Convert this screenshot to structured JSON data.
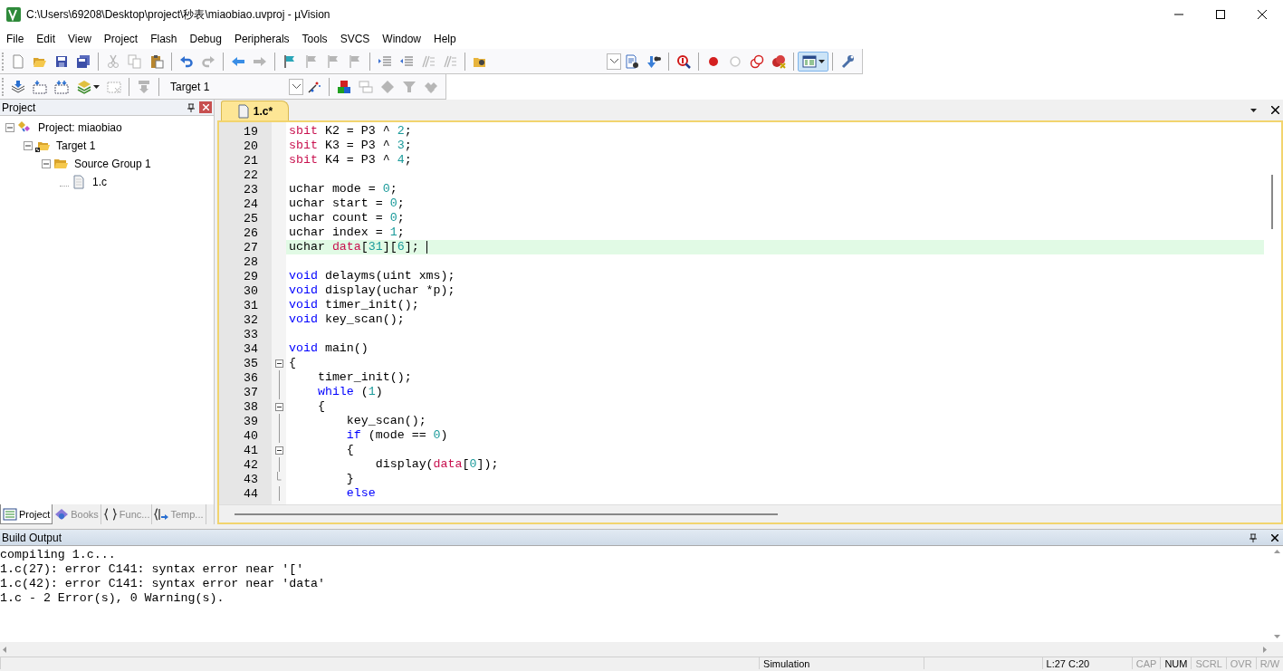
{
  "window": {
    "title": "C:\\Users\\69208\\Desktop\\project\\秒表\\miaobiao.uvproj - µVision"
  },
  "menu": [
    "File",
    "Edit",
    "View",
    "Project",
    "Flash",
    "Debug",
    "Peripherals",
    "Tools",
    "SVCS",
    "Window",
    "Help"
  ],
  "toolbar_1": [
    {
      "kind": "new-file",
      "disabled": false,
      "pressed": false
    },
    {
      "kind": "open-folder",
      "disabled": false,
      "pressed": false
    },
    {
      "kind": "save",
      "disabled": false,
      "pressed": false
    },
    {
      "kind": "save-all",
      "disabled": false,
      "pressed": false
    },
    {
      "kind": "separator"
    },
    {
      "kind": "scissors",
      "disabled": true,
      "pressed": false
    },
    {
      "kind": "copy",
      "disabled": true,
      "pressed": false
    },
    {
      "kind": "paste",
      "disabled": false,
      "pressed": false
    },
    {
      "kind": "separator"
    },
    {
      "kind": "undo",
      "disabled": false,
      "pressed": false
    },
    {
      "kind": "redo",
      "disabled": true,
      "pressed": false
    },
    {
      "kind": "separator"
    },
    {
      "kind": "left-arrow",
      "disabled": false,
      "pressed": false
    },
    {
      "kind": "right-arrow",
      "disabled": true,
      "pressed": false
    },
    {
      "kind": "separator"
    },
    {
      "kind": "flag",
      "disabled": false,
      "pressed": false
    },
    {
      "kind": "flag",
      "disabled": true,
      "pressed": false
    },
    {
      "kind": "flag",
      "disabled": true,
      "pressed": false
    },
    {
      "kind": "flag",
      "disabled": true,
      "pressed": false
    },
    {
      "kind": "separator"
    },
    {
      "kind": "indent",
      "disabled": false,
      "pressed": false
    },
    {
      "kind": "unindent",
      "disabled": false,
      "pressed": false
    },
    {
      "kind": "comment",
      "disabled": true,
      "pressed": false
    },
    {
      "kind": "uncomment",
      "disabled": true,
      "pressed": false
    },
    {
      "kind": "separator"
    },
    {
      "kind": "folder-search",
      "disabled": false,
      "pressed": false
    },
    {
      "kind": "combo"
    },
    {
      "kind": "document-search",
      "disabled": false,
      "pressed": false
    },
    {
      "kind": "arrow-binoculars",
      "disabled": false,
      "pressed": false
    },
    {
      "kind": "separator"
    },
    {
      "kind": "debug",
      "disabled": false,
      "pressed": false
    },
    {
      "kind": "separator"
    },
    {
      "kind": "breakpoint",
      "disabled": false,
      "pressed": false
    },
    {
      "kind": "hollow-circle",
      "disabled": true,
      "pressed": false
    },
    {
      "kind": "circles",
      "disabled": false,
      "pressed": false
    },
    {
      "kind": "dot-cross",
      "disabled": false,
      "pressed": false
    },
    {
      "kind": "separator"
    },
    {
      "kind": "window-layout",
      "disabled": false,
      "pressed": true
    },
    {
      "kind": "separator"
    },
    {
      "kind": "wrench",
      "disabled": false,
      "pressed": false
    }
  ],
  "toolbar_2": [
    {
      "kind": "stack-arrow",
      "disabled": false,
      "pressed": false
    },
    {
      "kind": "build",
      "disabled": false,
      "pressed": false
    },
    {
      "kind": "rebuild",
      "disabled": false,
      "pressed": false
    },
    {
      "kind": "layers",
      "disabled": false,
      "pressed": false
    },
    {
      "kind": "stop-build",
      "disabled": true,
      "pressed": false
    },
    {
      "kind": "separator"
    },
    {
      "kind": "load",
      "disabled": true,
      "pressed": false
    },
    {
      "kind": "separator"
    },
    {
      "kind": "target"
    },
    {
      "kind": "magic-wand",
      "disabled": false,
      "pressed": false
    },
    {
      "kind": "separator"
    },
    {
      "kind": "blocks",
      "disabled": false,
      "pressed": false
    },
    {
      "kind": "windows",
      "disabled": true,
      "pressed": false
    },
    {
      "kind": "diamond",
      "disabled": true,
      "pressed": false
    },
    {
      "kind": "funnel",
      "disabled": true,
      "pressed": false
    },
    {
      "kind": "diamonds",
      "disabled": true,
      "pressed": false
    }
  ],
  "target": "Target 1",
  "project_panel": {
    "title": "Project",
    "tree": [
      {
        "label": "Project: miaobiao",
        "kind": "project",
        "expanded": true,
        "children": [
          {
            "label": "Target 1",
            "kind": "target",
            "expanded": true,
            "children": [
              {
                "label": "Source Group 1",
                "kind": "group",
                "expanded": true,
                "children": [
                  {
                    "label": "1.c",
                    "kind": "file"
                  }
                ]
              }
            ]
          }
        ]
      }
    ],
    "tabs": [
      {
        "label": "Project",
        "kind": "project",
        "selected": true
      },
      {
        "label": "Books",
        "kind": "books",
        "selected": false
      },
      {
        "label": "Func...",
        "kind": "functions",
        "selected": false
      },
      {
        "label": "Temp...",
        "kind": "templates",
        "selected": false
      }
    ]
  },
  "editor": {
    "tabs": [
      {
        "label": "1.c*",
        "selected": true
      }
    ],
    "lines": [
      {
        "no": "19",
        "kind": "plain",
        "current": false,
        "tokens": [
          {
            "kind": "special",
            "text": "sbit"
          },
          {
            "kind": "plain",
            "text": " K2 = P3 ^ "
          },
          {
            "kind": "number",
            "text": "2"
          },
          {
            "kind": "plain",
            "text": ";"
          }
        ]
      },
      {
        "no": "20",
        "kind": "plain",
        "current": false,
        "tokens": [
          {
            "kind": "special",
            "text": "sbit"
          },
          {
            "kind": "plain",
            "text": " K3 = P3 ^ "
          },
          {
            "kind": "number",
            "text": "3"
          },
          {
            "kind": "plain",
            "text": ";"
          }
        ]
      },
      {
        "no": "21",
        "kind": "plain",
        "current": false,
        "tokens": [
          {
            "kind": "special",
            "text": "sbit"
          },
          {
            "kind": "plain",
            "text": " K4 = P3 ^ "
          },
          {
            "kind": "number",
            "text": "4"
          },
          {
            "kind": "plain",
            "text": ";"
          }
        ]
      },
      {
        "no": "22",
        "kind": "plain",
        "current": false
      },
      {
        "no": "23",
        "kind": "plain",
        "current": false,
        "tokens": [
          {
            "kind": "plain",
            "text": "uchar mode = "
          },
          {
            "kind": "number",
            "text": "0"
          },
          {
            "kind": "plain",
            "text": ";"
          }
        ]
      },
      {
        "no": "24",
        "kind": "plain",
        "current": false,
        "tokens": [
          {
            "kind": "plain",
            "text": "uchar start = "
          },
          {
            "kind": "number",
            "text": "0"
          },
          {
            "kind": "plain",
            "text": ";"
          }
        ]
      },
      {
        "no": "25",
        "kind": "plain",
        "current": false,
        "tokens": [
          {
            "kind": "plain",
            "text": "uchar count = "
          },
          {
            "kind": "number",
            "text": "0"
          },
          {
            "kind": "plain",
            "text": ";"
          }
        ]
      },
      {
        "no": "26",
        "kind": "plain",
        "current": false,
        "tokens": [
          {
            "kind": "plain",
            "text": "uchar index = "
          },
          {
            "kind": "number",
            "text": "1"
          },
          {
            "kind": "plain",
            "text": ";"
          }
        ]
      },
      {
        "no": "27",
        "kind": "plain",
        "current": true,
        "tokens": [
          {
            "kind": "plain",
            "text": "uchar "
          },
          {
            "kind": "special",
            "text": "data"
          },
          {
            "kind": "plain",
            "text": "["
          },
          {
            "kind": "number",
            "text": "31"
          },
          {
            "kind": "plain",
            "text": "]["
          },
          {
            "kind": "number",
            "text": "6"
          },
          {
            "kind": "plain",
            "text": "];"
          }
        ]
      },
      {
        "no": "28",
        "kind": "plain",
        "current": false
      },
      {
        "no": "29",
        "kind": "plain",
        "current": false,
        "tokens": [
          {
            "kind": "keyword",
            "text": "void"
          },
          {
            "kind": "plain",
            "text": " delayms(uint xms);"
          }
        ]
      },
      {
        "no": "30",
        "kind": "plain",
        "current": false,
        "tokens": [
          {
            "kind": "keyword",
            "text": "void"
          },
          {
            "kind": "plain",
            "text": " display(uchar *p);"
          }
        ]
      },
      {
        "no": "31",
        "kind": "plain",
        "current": false,
        "tokens": [
          {
            "kind": "keyword",
            "text": "void"
          },
          {
            "kind": "plain",
            "text": " timer_init();"
          }
        ]
      },
      {
        "no": "32",
        "kind": "plain",
        "current": false,
        "tokens": [
          {
            "kind": "keyword",
            "text": "void"
          },
          {
            "kind": "plain",
            "text": " key_scan();"
          }
        ]
      },
      {
        "no": "33",
        "kind": "plain",
        "current": false
      },
      {
        "no": "34",
        "kind": "plain",
        "current": false,
        "tokens": [
          {
            "kind": "keyword",
            "text": "void"
          },
          {
            "kind": "plain",
            "text": " main()"
          }
        ]
      },
      {
        "no": "35",
        "kind": "fold-start",
        "current": false,
        "tokens": [
          {
            "kind": "plain",
            "text": "{"
          }
        ]
      },
      {
        "no": "36",
        "kind": "folded",
        "current": false,
        "tokens": [
          {
            "kind": "plain",
            "text": "    timer_init();"
          }
        ]
      },
      {
        "no": "37",
        "kind": "folded",
        "current": false,
        "tokens": [
          {
            "kind": "keyword",
            "text": "    while"
          },
          {
            "kind": "plain",
            "text": " ("
          },
          {
            "kind": "number",
            "text": "1"
          },
          {
            "kind": "plain",
            "text": ")"
          }
        ]
      },
      {
        "no": "38",
        "kind": "fold-start",
        "current": false,
        "tokens": [
          {
            "kind": "plain",
            "text": "    {"
          }
        ]
      },
      {
        "no": "39",
        "kind": "folded",
        "current": false,
        "tokens": [
          {
            "kind": "plain",
            "text": "        key_scan();"
          }
        ]
      },
      {
        "no": "40",
        "kind": "folded",
        "current": false,
        "tokens": [
          {
            "kind": "keyword",
            "text": "        if"
          },
          {
            "kind": "plain",
            "text": " (mode == "
          },
          {
            "kind": "number",
            "text": "0"
          },
          {
            "kind": "plain",
            "text": ")"
          }
        ]
      },
      {
        "no": "41",
        "kind": "fold-start",
        "current": false,
        "tokens": [
          {
            "kind": "plain",
            "text": "        {"
          }
        ]
      },
      {
        "no": "42",
        "kind": "folded",
        "current": false,
        "tokens": [
          {
            "kind": "plain",
            "text": "            display("
          },
          {
            "kind": "special",
            "text": "data"
          },
          {
            "kind": "plain",
            "text": "["
          },
          {
            "kind": "number",
            "text": "0"
          },
          {
            "kind": "plain",
            "text": "]);"
          }
        ]
      },
      {
        "no": "43",
        "kind": "fold-end",
        "current": false,
        "tokens": [
          {
            "kind": "plain",
            "text": "        }"
          }
        ]
      },
      {
        "no": "44",
        "kind": "folded",
        "current": false,
        "tokens": [
          {
            "kind": "keyword",
            "text": "        else"
          }
        ]
      }
    ]
  },
  "build_output": {
    "title": "Build Output",
    "lines": [
      "compiling 1.c...",
      "1.c(27): error C141: syntax error near '['",
      "1.c(42): error C141: syntax error near 'data'",
      "1.c - 2 Error(s), 0 Warning(s)."
    ]
  },
  "status_bar": {
    "mode": "Simulation",
    "position": "L:27 C:20",
    "indicators": [
      {
        "text": "CAP",
        "on": false
      },
      {
        "text": "NUM",
        "on": true
      },
      {
        "text": "SCRL",
        "on": false
      },
      {
        "text": "OVR",
        "on": false
      },
      {
        "text": "R/W",
        "on": false
      }
    ]
  }
}
